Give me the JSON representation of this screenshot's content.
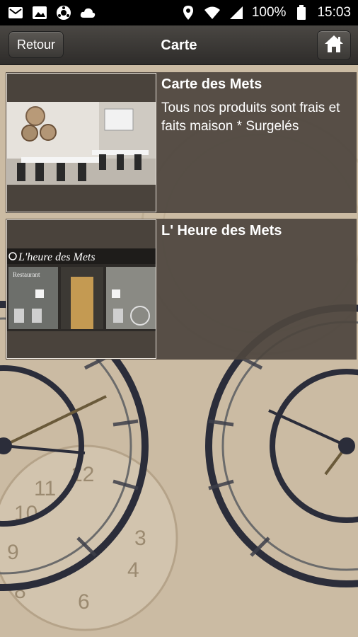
{
  "status_bar": {
    "battery": "100%",
    "time": "15:03",
    "icons": [
      "gmail-icon",
      "gallery-icon",
      "app-icon",
      "cloud-icon",
      "location-icon",
      "wifi-icon",
      "signal-icon",
      "battery-icon"
    ]
  },
  "header": {
    "back_label": "Retour",
    "title": "Carte",
    "home_icon": "home-icon"
  },
  "items": [
    {
      "title": "Carte des Mets",
      "description": "Tous nos produits sont frais et faits maison * Surgelés"
    },
    {
      "title": "L' Heure des Mets",
      "description": ""
    }
  ],
  "storefront": {
    "sign": "L'heure des Mets",
    "left_window": "Restaurant"
  },
  "colors": {
    "statusbar": "#000000",
    "header": "#3a3835",
    "item_bg": "#4e463e",
    "background": "#cbbba3",
    "text": "#ffffff"
  }
}
